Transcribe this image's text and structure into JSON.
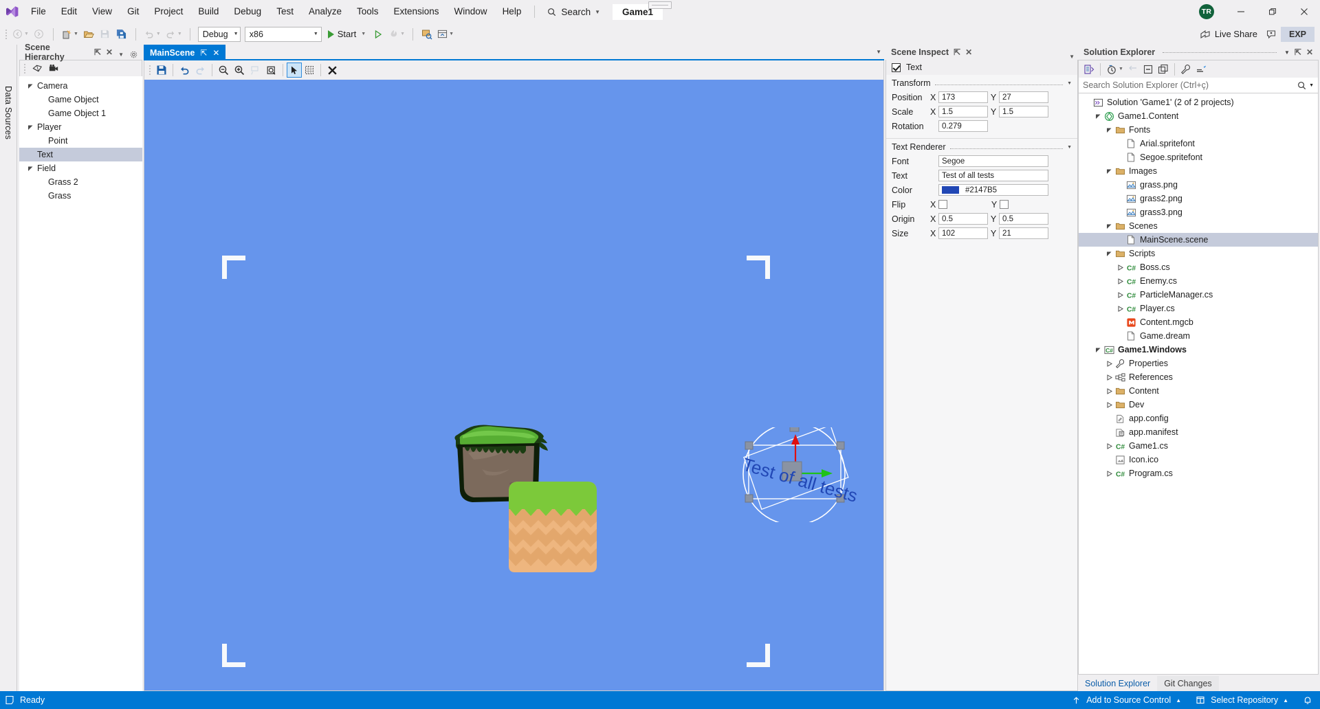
{
  "titlebar": {
    "menus": [
      "File",
      "Edit",
      "View",
      "Git",
      "Project",
      "Build",
      "Debug",
      "Test",
      "Analyze",
      "Tools",
      "Extensions",
      "Window",
      "Help"
    ],
    "search_label": "Search",
    "project_chip": "Game1",
    "avatar_initials": "TR",
    "minimize_icon": "minimize-icon",
    "restore_icon": "restore-icon",
    "close_icon": "close-icon"
  },
  "toolbar": {
    "back_icon": "navigate-back-icon",
    "forward_icon": "navigate-forward-icon",
    "new_project_icon": "new-project-icon",
    "open_icon": "open-file-icon",
    "save_icon": "save-icon",
    "save_all_icon": "save-all-icon",
    "undo_icon": "undo-icon",
    "redo_icon": "redo-icon",
    "configuration": "Debug",
    "platform": "x86",
    "start_label": "Start",
    "attach_icon": "start-without-debugging-icon",
    "hotreload_icon": "hot-reload-icon",
    "selector_icon": "select-element-icon",
    "layout_icon": "window-layout-icon",
    "live_share_label": "Live Share",
    "feedback_icon": "send-feedback-icon",
    "exp_label": "EXP"
  },
  "left_strip": {
    "label": "Data Sources"
  },
  "scene_hierarchy": {
    "tab_title": "Scene Hierarchy",
    "pin_icon": "pin-icon",
    "close_icon": "close-icon",
    "chevron_icon": "chevron-down-icon",
    "settings_icon": "gear-icon",
    "toolbar": [
      {
        "name": "scene-object-icon"
      },
      {
        "name": "camera-icon"
      }
    ],
    "tree": [
      {
        "label": "Camera",
        "depth": 0,
        "expander": "expanded",
        "selected": false
      },
      {
        "label": "Game Object",
        "depth": 1,
        "expander": "none",
        "selected": false
      },
      {
        "label": "Game Object 1",
        "depth": 1,
        "expander": "none",
        "selected": false
      },
      {
        "label": "Player",
        "depth": 0,
        "expander": "expanded",
        "selected": false
      },
      {
        "label": "Point",
        "depth": 1,
        "expander": "none",
        "selected": false
      },
      {
        "label": "Text",
        "depth": 0,
        "expander": "none",
        "selected": true
      },
      {
        "label": "Field",
        "depth": 0,
        "expander": "expanded",
        "selected": false
      },
      {
        "label": "Grass 2",
        "depth": 1,
        "expander": "none",
        "selected": false
      },
      {
        "label": "Grass",
        "depth": 1,
        "expander": "none",
        "selected": false
      }
    ]
  },
  "editor": {
    "tab_title": "MainScene",
    "pin_icon": "pin-icon",
    "close_icon": "close-icon",
    "toolbar": [
      {
        "name": "save-scene-icon",
        "state": "enabled"
      },
      {
        "name": "undo-icon",
        "state": "enabled"
      },
      {
        "name": "redo-icon",
        "state": "disabled"
      },
      {
        "name": "zoom-out-icon",
        "state": "enabled"
      },
      {
        "name": "zoom-in-icon",
        "state": "enabled"
      },
      {
        "name": "zoom-reset-icon",
        "state": "disabled"
      },
      {
        "name": "focus-object-icon",
        "state": "enabled"
      },
      {
        "name": "select-tool-icon",
        "state": "active"
      },
      {
        "name": "grid-snap-icon",
        "state": "enabled"
      },
      {
        "name": "delete-icon",
        "state": "enabled"
      }
    ],
    "viewport": {
      "background_color": "#6695ec",
      "text_object": "Test of all tests",
      "text_color": "#2147b5",
      "rotation_deg": 16,
      "gizmo_x_axis_color": "#1fc218",
      "gizmo_y_axis_color": "#e01010"
    }
  },
  "scene_inspect": {
    "tab_title": "Scene Inspect",
    "pin_icon": "pin-icon",
    "close_icon": "close-icon",
    "chevron_icon": "chevron-down-icon",
    "object_name": "Text",
    "object_enabled": true,
    "sections": [
      {
        "title": "Transform",
        "rows": [
          {
            "label": "Position",
            "type": "xy",
            "x": "173",
            "y": "27"
          },
          {
            "label": "Scale",
            "type": "xy",
            "x": "1.5",
            "y": "1.5"
          },
          {
            "label": "Rotation",
            "type": "single",
            "value": "0.279"
          }
        ]
      },
      {
        "title": "Text Renderer",
        "rows": [
          {
            "label": "Font",
            "type": "full",
            "value": "Segoe"
          },
          {
            "label": "Text",
            "type": "full",
            "value": "Test of all tests"
          },
          {
            "label": "Color",
            "type": "color",
            "value": "#2147B5",
            "swatch": "#2147b5"
          },
          {
            "label": "Flip",
            "type": "checkxy",
            "x": false,
            "y": false
          },
          {
            "label": "Origin",
            "type": "xy",
            "x": "0.5",
            "y": "0.5"
          },
          {
            "label": "Size",
            "type": "xy",
            "x": "102",
            "y": "21"
          }
        ]
      }
    ]
  },
  "solution_explorer": {
    "tab_title": "Solution Explorer",
    "chevron_icon": "chevron-down-icon",
    "pin_icon": "pin-icon",
    "close_icon": "close-icon",
    "toolbar": [
      {
        "name": "solution-view-icon"
      },
      {
        "name": "pending-changes-icon"
      },
      {
        "name": "sync-navigation-icon"
      },
      {
        "name": "collapse-all-icon"
      },
      {
        "name": "show-all-files-icon"
      },
      {
        "name": "properties-icon"
      },
      {
        "name": "preview-selected-icon"
      }
    ],
    "search_placeholder": "Search Solution Explorer (Ctrl+ç)",
    "search_icon": "search-icon",
    "tree": [
      {
        "label": "Solution 'Game1' (2 of 2 projects)",
        "depth": 0,
        "expander": "none",
        "icon": "solution-icon",
        "bold": false,
        "selected": false
      },
      {
        "label": "Game1.Content",
        "depth": 1,
        "expander": "expanded",
        "icon": "monogame-icon",
        "bold": false,
        "selected": false
      },
      {
        "label": "Fonts",
        "depth": 2,
        "expander": "expanded",
        "icon": "folder-icon",
        "bold": false,
        "selected": false
      },
      {
        "label": "Arial.spritefont",
        "depth": 3,
        "expander": "none",
        "icon": "file-icon",
        "bold": false,
        "selected": false
      },
      {
        "label": "Segoe.spritefont",
        "depth": 3,
        "expander": "none",
        "icon": "file-icon",
        "bold": false,
        "selected": false
      },
      {
        "label": "Images",
        "depth": 2,
        "expander": "expanded",
        "icon": "folder-icon",
        "bold": false,
        "selected": false
      },
      {
        "label": "grass.png",
        "depth": 3,
        "expander": "none",
        "icon": "image-icon",
        "bold": false,
        "selected": false
      },
      {
        "label": "grass2.png",
        "depth": 3,
        "expander": "none",
        "icon": "image-icon",
        "bold": false,
        "selected": false
      },
      {
        "label": "grass3.png",
        "depth": 3,
        "expander": "none",
        "icon": "image-icon",
        "bold": false,
        "selected": false
      },
      {
        "label": "Scenes",
        "depth": 2,
        "expander": "expanded",
        "icon": "folder-icon",
        "bold": false,
        "selected": false
      },
      {
        "label": "MainScene.scene",
        "depth": 3,
        "expander": "none",
        "icon": "file-icon",
        "bold": false,
        "selected": true
      },
      {
        "label": "Scripts",
        "depth": 2,
        "expander": "expanded",
        "icon": "folder-icon",
        "bold": false,
        "selected": false
      },
      {
        "label": "Boss.cs",
        "depth": 3,
        "expander": "collapsed",
        "icon": "csharp-icon",
        "bold": false,
        "selected": false
      },
      {
        "label": "Enemy.cs",
        "depth": 3,
        "expander": "collapsed",
        "icon": "csharp-icon",
        "bold": false,
        "selected": false
      },
      {
        "label": "ParticleManager.cs",
        "depth": 3,
        "expander": "collapsed",
        "icon": "csharp-icon",
        "bold": false,
        "selected": false
      },
      {
        "label": "Player.cs",
        "depth": 3,
        "expander": "collapsed",
        "icon": "csharp-icon",
        "bold": false,
        "selected": false
      },
      {
        "label": "Content.mgcb",
        "depth": 3,
        "expander": "none",
        "icon": "mgcb-icon",
        "bold": false,
        "selected": false
      },
      {
        "label": "Game.dream",
        "depth": 3,
        "expander": "none",
        "icon": "file-icon",
        "bold": false,
        "selected": false
      },
      {
        "label": "Game1.Windows",
        "depth": 1,
        "expander": "expanded",
        "icon": "csproj-icon",
        "bold": true,
        "selected": false
      },
      {
        "label": "Properties",
        "depth": 2,
        "expander": "collapsed",
        "icon": "properties-icon",
        "bold": false,
        "selected": false
      },
      {
        "label": "References",
        "depth": 2,
        "expander": "collapsed",
        "icon": "references-icon",
        "bold": false,
        "selected": false
      },
      {
        "label": "Content",
        "depth": 2,
        "expander": "collapsed",
        "icon": "folder-icon",
        "bold": false,
        "selected": false
      },
      {
        "label": "Dev",
        "depth": 2,
        "expander": "collapsed",
        "icon": "folder-icon",
        "bold": false,
        "selected": false
      },
      {
        "label": "app.config",
        "depth": 2,
        "expander": "none",
        "icon": "config-icon",
        "bold": false,
        "selected": false
      },
      {
        "label": "app.manifest",
        "depth": 2,
        "expander": "none",
        "icon": "manifest-icon",
        "bold": false,
        "selected": false
      },
      {
        "label": "Game1.cs",
        "depth": 2,
        "expander": "collapsed",
        "icon": "csharp-icon",
        "bold": false,
        "selected": false
      },
      {
        "label": "Icon.ico",
        "depth": 2,
        "expander": "none",
        "icon": "ico-icon",
        "bold": false,
        "selected": false
      },
      {
        "label": "Program.cs",
        "depth": 2,
        "expander": "collapsed",
        "icon": "csharp-icon",
        "bold": false,
        "selected": false
      }
    ],
    "bottom_tabs": [
      {
        "label": "Solution Explorer",
        "active": true
      },
      {
        "label": "Git Changes",
        "active": false
      }
    ]
  },
  "statusbar": {
    "ready_label": "Ready",
    "ready_icon": "status-ready-icon",
    "add_source_control": "Add to Source Control",
    "add_source_control_icon": "upload-arrow-icon",
    "select_repository": "Select Repository",
    "select_repository_icon": "repository-icon",
    "notifications_icon": "bell-icon"
  }
}
